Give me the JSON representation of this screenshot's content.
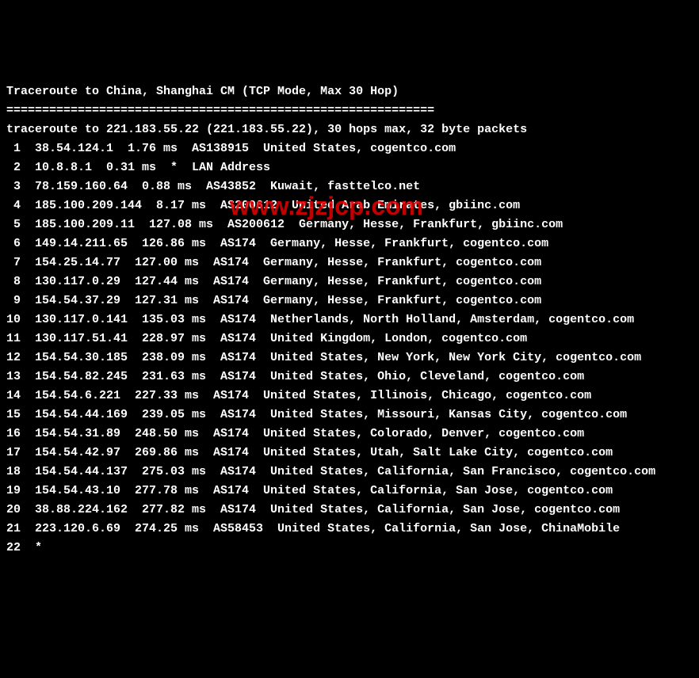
{
  "title": "Traceroute to China, Shanghai CM (TCP Mode, Max 30 Hop)",
  "separator": "============================================================",
  "header": "traceroute to 221.183.55.22 (221.183.55.22), 30 hops max, 32 byte packets",
  "hops": [
    {
      "n": " 1",
      "ip": "38.54.124.1",
      "lat": "1.76 ms",
      "asn": "AS138915",
      "loc": "United States, cogentco.com"
    },
    {
      "n": " 2",
      "ip": "10.8.8.1",
      "lat": "0.31 ms",
      "asn": "*",
      "loc": "LAN Address"
    },
    {
      "n": " 3",
      "ip": "78.159.160.64",
      "lat": "0.88 ms",
      "asn": "AS43852",
      "loc": "Kuwait, fasttelco.net"
    },
    {
      "n": " 4",
      "ip": "185.100.209.144",
      "lat": "8.17 ms",
      "asn": "AS200612",
      "loc": "United Arab Emirates, gbiinc.com"
    },
    {
      "n": " 5",
      "ip": "185.100.209.11",
      "lat": "127.08 ms",
      "asn": "AS200612",
      "loc": "Germany, Hesse, Frankfurt, gbiinc.com"
    },
    {
      "n": " 6",
      "ip": "149.14.211.65",
      "lat": "126.86 ms",
      "asn": "AS174",
      "loc": "Germany, Hesse, Frankfurt, cogentco.com"
    },
    {
      "n": " 7",
      "ip": "154.25.14.77",
      "lat": "127.00 ms",
      "asn": "AS174",
      "loc": "Germany, Hesse, Frankfurt, cogentco.com"
    },
    {
      "n": " 8",
      "ip": "130.117.0.29",
      "lat": "127.44 ms",
      "asn": "AS174",
      "loc": "Germany, Hesse, Frankfurt, cogentco.com"
    },
    {
      "n": " 9",
      "ip": "154.54.37.29",
      "lat": "127.31 ms",
      "asn": "AS174",
      "loc": "Germany, Hesse, Frankfurt, cogentco.com"
    },
    {
      "n": "10",
      "ip": "130.117.0.141",
      "lat": "135.03 ms",
      "asn": "AS174",
      "loc": "Netherlands, North Holland, Amsterdam, cogentco.com"
    },
    {
      "n": "11",
      "ip": "130.117.51.41",
      "lat": "228.97 ms",
      "asn": "AS174",
      "loc": "United Kingdom, London, cogentco.com"
    },
    {
      "n": "12",
      "ip": "154.54.30.185",
      "lat": "238.09 ms",
      "asn": "AS174",
      "loc": "United States, New York, New York City, cogentco.com"
    },
    {
      "n": "13",
      "ip": "154.54.82.245",
      "lat": "231.63 ms",
      "asn": "AS174",
      "loc": "United States, Ohio, Cleveland, cogentco.com"
    },
    {
      "n": "14",
      "ip": "154.54.6.221",
      "lat": "227.33 ms",
      "asn": "AS174",
      "loc": "United States, Illinois, Chicago, cogentco.com"
    },
    {
      "n": "15",
      "ip": "154.54.44.169",
      "lat": "239.05 ms",
      "asn": "AS174",
      "loc": "United States, Missouri, Kansas City, cogentco.com"
    },
    {
      "n": "16",
      "ip": "154.54.31.89",
      "lat": "248.50 ms",
      "asn": "AS174",
      "loc": "United States, Colorado, Denver, cogentco.com"
    },
    {
      "n": "17",
      "ip": "154.54.42.97",
      "lat": "269.86 ms",
      "asn": "AS174",
      "loc": "United States, Utah, Salt Lake City, cogentco.com"
    },
    {
      "n": "18",
      "ip": "154.54.44.137",
      "lat": "275.03 ms",
      "asn": "AS174",
      "loc": "United States, California, San Francisco, cogentco.com"
    },
    {
      "n": "19",
      "ip": "154.54.43.10",
      "lat": "277.78 ms",
      "asn": "AS174",
      "loc": "United States, California, San Jose, cogentco.com"
    },
    {
      "n": "20",
      "ip": "38.88.224.162",
      "lat": "277.82 ms",
      "asn": "AS174",
      "loc": "United States, California, San Jose, cogentco.com"
    },
    {
      "n": "21",
      "ip": "223.120.6.69",
      "lat": "274.25 ms",
      "asn": "AS58453",
      "loc": "United States, California, San Jose, ChinaMobile"
    }
  ],
  "lasthop": "22  *",
  "watermark": "www.zjzjcp.com"
}
